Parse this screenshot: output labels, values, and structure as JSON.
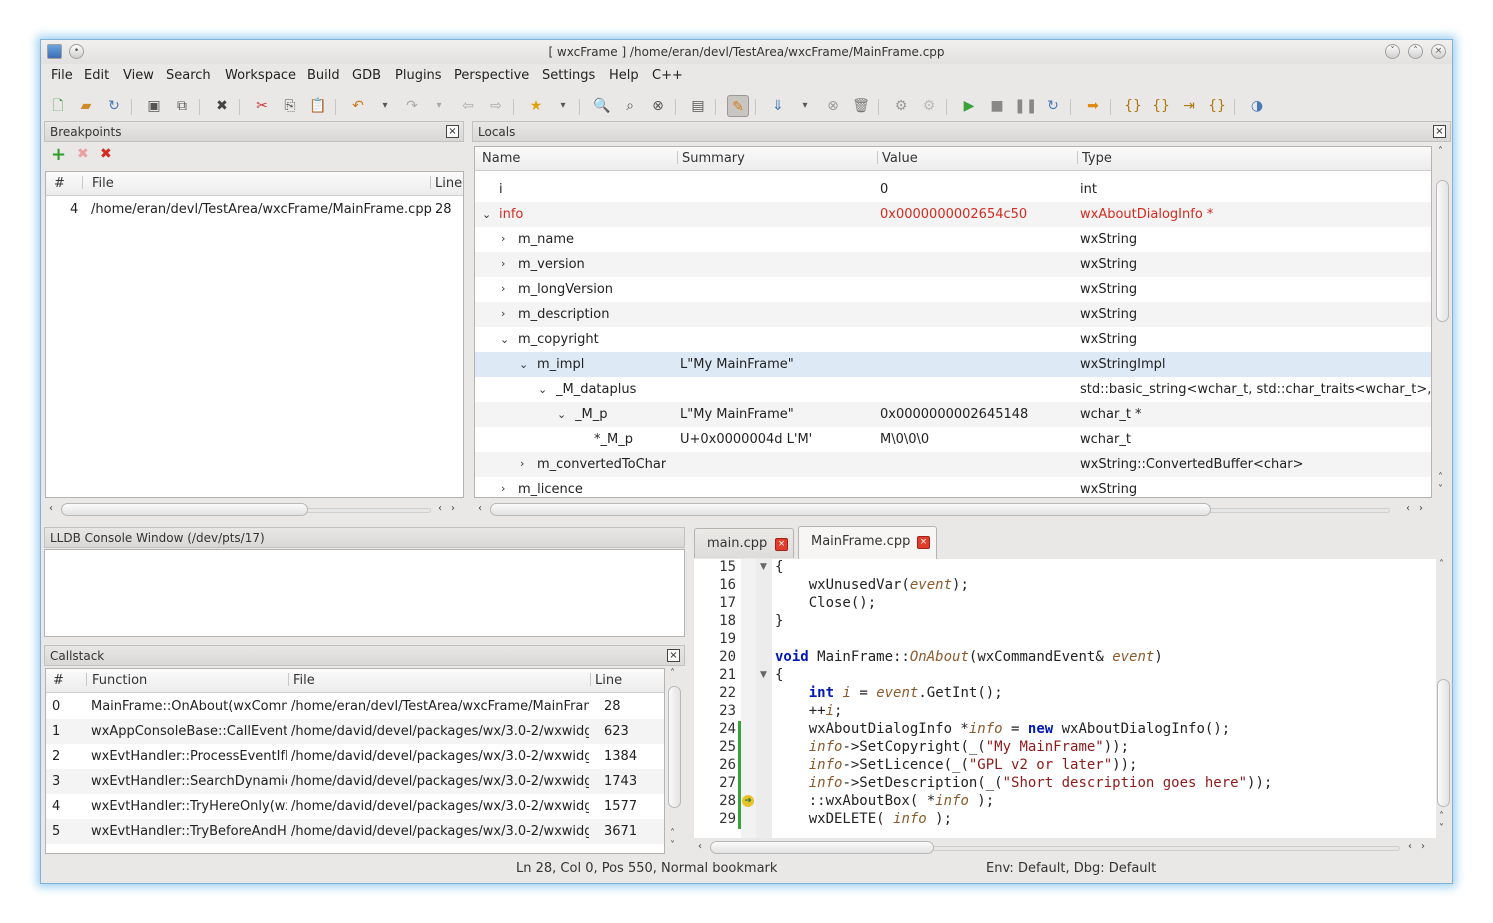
{
  "window": {
    "title": "[ wxcFrame ] /home/eran/devl/TestArea/wxcFrame/MainFrame.cpp"
  },
  "menu": [
    "File",
    "Edit",
    "View",
    "Search",
    "Workspace",
    "Build",
    "GDB",
    "Plugins",
    "Perspective",
    "Settings",
    "Help",
    "C++"
  ],
  "breakpoints": {
    "title": "Breakpoints",
    "columns": [
      "#",
      "File",
      "Line"
    ],
    "rows": [
      {
        "num": "4",
        "file": "/home/eran/devl/TestArea/wxcFrame/MainFrame.cpp",
        "line": "28"
      }
    ]
  },
  "locals": {
    "title": "Locals",
    "columns": [
      "Name",
      "Summary",
      "Value",
      "Type"
    ],
    "rows": [
      {
        "name": "i",
        "summary": "",
        "value": "0",
        "type": "int"
      },
      {
        "name": "info",
        "summary": "",
        "value": "0x0000000002654c50",
        "type": "wxAboutDialogInfo *"
      },
      {
        "name": "m_name",
        "summary": "",
        "value": "",
        "type": "wxString"
      },
      {
        "name": "m_version",
        "summary": "",
        "value": "",
        "type": "wxString"
      },
      {
        "name": "m_longVersion",
        "summary": "",
        "value": "",
        "type": "wxString"
      },
      {
        "name": "m_description",
        "summary": "",
        "value": "",
        "type": "wxString"
      },
      {
        "name": "m_copyright",
        "summary": "",
        "value": "",
        "type": "wxString"
      },
      {
        "name": "m_impl",
        "summary": "L\"My MainFrame\"",
        "value": "",
        "type": "wxStringImpl"
      },
      {
        "name": "_M_dataplus",
        "summary": "",
        "value": "",
        "type": "std::basic_string<wchar_t, std::char_traits<wchar_t>, s"
      },
      {
        "name": "_M_p",
        "summary": "L\"My MainFrame\"",
        "value": "0x0000000002645148",
        "type": "wchar_t *"
      },
      {
        "name": "*_M_p",
        "summary": "U+0x0000004d L'M'",
        "value": "M\\0\\0\\0",
        "type": "wchar_t"
      },
      {
        "name": "m_convertedToChar",
        "summary": "",
        "value": "",
        "type": "wxString::ConvertedBuffer<char>"
      },
      {
        "name": "m_licence",
        "summary": "",
        "value": "",
        "type": "wxString"
      }
    ]
  },
  "console": {
    "title": "LLDB Console Window (/dev/pts/17)"
  },
  "callstack": {
    "title": "Callstack",
    "columns": [
      "#",
      "Function",
      "File",
      "Line"
    ],
    "rows": [
      {
        "num": "0",
        "func": "MainFrame::OnAbout(wxComm",
        "file": "/home/eran/devl/TestArea/wxcFrame/MainFram",
        "line": "28"
      },
      {
        "num": "1",
        "func": "wxAppConsoleBase::CallEventH",
        "file": "/home/david/devel/packages/wx/3.0-2/wxwidge",
        "line": "623"
      },
      {
        "num": "2",
        "func": "wxEvtHandler::ProcessEventIfM",
        "file": "/home/david/devel/packages/wx/3.0-2/wxwidge",
        "line": "1384"
      },
      {
        "num": "3",
        "func": "wxEvtHandler::SearchDynamic",
        "file": "/home/david/devel/packages/wx/3.0-2/wxwidge",
        "line": "1743"
      },
      {
        "num": "4",
        "func": "wxEvtHandler::TryHereOnly(wxE",
        "file": "/home/david/devel/packages/wx/3.0-2/wxwidge",
        "line": "1577"
      },
      {
        "num": "5",
        "func": "wxEvtHandler::TryBeforeAndHe",
        "file": "/home/david/devel/packages/wx/3.0-2/wxwidge",
        "line": "3671"
      }
    ]
  },
  "tabs": [
    {
      "label": "main.cpp"
    },
    {
      "label": "MainFrame.cpp"
    }
  ],
  "editor": {
    "lines": [
      "15",
      "16",
      "17",
      "18",
      "19",
      "20",
      "21",
      "22",
      "23",
      "24",
      "25",
      "26",
      "27",
      "28",
      "29"
    ]
  },
  "status": {
    "position": "Ln 28,  Col 0,  Pos 550, Normal bookmark",
    "env": "Env: Default, Dbg: Default"
  }
}
